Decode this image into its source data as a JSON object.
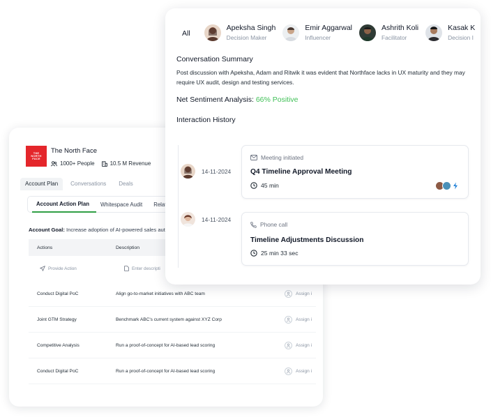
{
  "account": {
    "name": "The North Face",
    "logo_text": [
      "THE",
      "NORTH",
      "FACE"
    ],
    "people_count": "1000+ People",
    "revenue": "10.5 M Revenue",
    "tabs": [
      "Account Plan",
      "Conversations",
      "Deals"
    ],
    "sub_tabs": [
      "Account Action Plan",
      "Whitespace Audit",
      "Relatio"
    ],
    "goal_label": "Account Goal:",
    "goal_text": "Increase adoption of AI-powered sales aut",
    "table": {
      "headers": [
        "Actions",
        "Description"
      ],
      "action_placeholder": "Provide Action",
      "description_placeholder": "Enter descripti",
      "assign_label": "Assign i",
      "rows": [
        {
          "action": "Conduct Digital PoC",
          "description": "Align go-to-market initiatives with ABC team"
        },
        {
          "action": "Joint GTM Strategy",
          "description": "Benchmark ABC's current system against XYZ Corp"
        },
        {
          "action": "Competitive Analysis",
          "description": "Run a proof-of-concept for AI-based lead scoring"
        },
        {
          "action": "Conduct Digital PoC",
          "description": "Run a proof-of-concept for AI-based lead scoring"
        }
      ]
    }
  },
  "conversation": {
    "all_label": "All",
    "people": [
      {
        "name": "Apeksha Singh",
        "role": "Decision Maker",
        "color": "#8d5a45"
      },
      {
        "name": "Emir Aggarwal",
        "role": "Influencer",
        "color": "#c9a58a"
      },
      {
        "name": "Ashrith Koli",
        "role": "Facilitator",
        "color": "#3b4a3f"
      },
      {
        "name": "Kasak K",
        "role": "Decision I",
        "color": "#2c2c30"
      }
    ],
    "summary_title": "Conversation Summary",
    "summary_text": "Post discussion with Apeksha, Adam and Ritwik it was evident that Northface lacks in UX maturity and they may require UX audit, design and testing services.",
    "sentiment_label": "Net Sentiment Analysis:",
    "sentiment_value": "66% Positive",
    "history_title": "Interaction History",
    "events": [
      {
        "date": "14-11-2024",
        "type": "Meeting initiated",
        "title": "Q4 Timeline Approval Meeting",
        "duration": "45 min"
      },
      {
        "date": "14-11-2024",
        "type": "Phone call",
        "title": "Timeline Adjustments Discussion",
        "duration": "25 min 33 sec"
      }
    ],
    "colors": {
      "positive": "#40c057",
      "active_tab": "#2f9e44"
    }
  }
}
